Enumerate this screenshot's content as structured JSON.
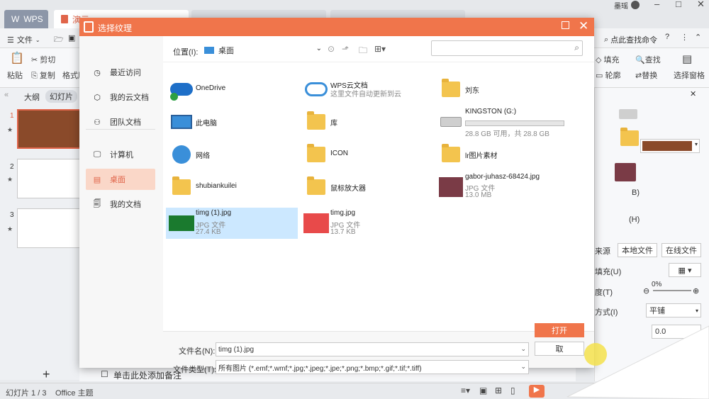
{
  "wps_tab": "WPS",
  "tabs": [
    "演示",
    "",
    "",
    ""
  ],
  "user": "墨瑶",
  "menu": {
    "file": "文件",
    "search_cmd": "点此查找命令"
  },
  "ribbon": {
    "paste": "粘贴",
    "cut": "剪切",
    "copy": "复制",
    "format": "格式刷",
    "fill": "填充",
    "outline": "轮廓",
    "find": "查找",
    "replace": "替换",
    "select_pane": "选择窗格"
  },
  "panel_tabs": {
    "outline": "大纲",
    "slides": "幻灯片"
  },
  "slides": [
    "1",
    "2",
    "3"
  ],
  "notes_placeholder": "单击此处添加备注",
  "status": {
    "slide_count": "幻灯片 1 / 3",
    "theme": "Office 主题"
  },
  "right_panel": {
    "source": "来源",
    "local_file": "本地文件",
    "online_file": "在线文件",
    "fill_label": "填充(U)",
    "transparency_label": "度(T)",
    "transparency_value": "0%",
    "mode_label": "方式(I)",
    "mode_value": "平铺",
    "h_label": "(H)",
    "b_label": "B)",
    "offset_value": "0.0"
  },
  "dialog": {
    "title": "选择纹理",
    "sidebar": [
      {
        "label": "最近访问",
        "icon": "clock-icon"
      },
      {
        "label": "我的云文档",
        "icon": "cube-icon"
      },
      {
        "label": "团队文档",
        "icon": "team-icon"
      },
      {
        "label": "计算机",
        "icon": "monitor-icon"
      },
      {
        "label": "桌面",
        "icon": "desktop-icon"
      },
      {
        "label": "我的文档",
        "icon": "documents-icon"
      }
    ],
    "location_label": "位置(I):",
    "location_value": "桌面",
    "search_placeholder": "",
    "files": [
      {
        "name": "OneDrive",
        "sub1": "",
        "sub2": "",
        "icon": "onedrive-icon"
      },
      {
        "name": "WPS云文档",
        "sub1": "这里文件自动更新到云",
        "sub2": "",
        "icon": "wps-cloud-icon"
      },
      {
        "name": "刘东",
        "sub1": "",
        "sub2": "",
        "icon": "user-folder-icon"
      },
      {
        "name": "此电脑",
        "sub1": "",
        "sub2": "",
        "icon": "computer-icon"
      },
      {
        "name": "库",
        "sub1": "",
        "sub2": "",
        "icon": "library-icon"
      },
      {
        "name": "KINGSTON (G:)",
        "sub1": "28.8 GB 可用，共 28.8 GB",
        "sub2": "",
        "icon": "drive-icon"
      },
      {
        "name": "网络",
        "sub1": "",
        "sub2": "",
        "icon": "network-icon"
      },
      {
        "name": "ICON",
        "sub1": "",
        "sub2": "",
        "icon": "folder-icon"
      },
      {
        "name": "lr图片素材",
        "sub1": "",
        "sub2": "",
        "icon": "folder-icon"
      },
      {
        "name": "shubiankuilei",
        "sub1": "",
        "sub2": "",
        "icon": "folder-icon"
      },
      {
        "name": "鼠标放大器",
        "sub1": "",
        "sub2": "",
        "icon": "folder-icon"
      },
      {
        "name": "gabor-juhasz-68424.jpg",
        "sub1": "JPG 文件",
        "sub2": "13.0 MB",
        "icon": "image-thumb-icon"
      },
      {
        "name": "timg (1).jpg",
        "sub1": "JPG 文件",
        "sub2": "27.4 KB",
        "icon": "image-thumb-icon"
      },
      {
        "name": "timg.jpg",
        "sub1": "JPG 文件",
        "sub2": "13.7 KB",
        "icon": "image-thumb-icon"
      }
    ],
    "filename_label": "文件名(N):",
    "filename_value": "timg (1).jpg",
    "filetype_label": "文件类型(T):",
    "filetype_value": "所有图片 (*.emf;*.wmf;*.jpg;*.jpeg;*.jpe;*.png;*.bmp;*.gif;*.tif;*.tiff)",
    "open_label": "打开",
    "cancel_label": "取"
  },
  "colors": {
    "accent": "#f0754b",
    "selection": "#cce8ff"
  }
}
